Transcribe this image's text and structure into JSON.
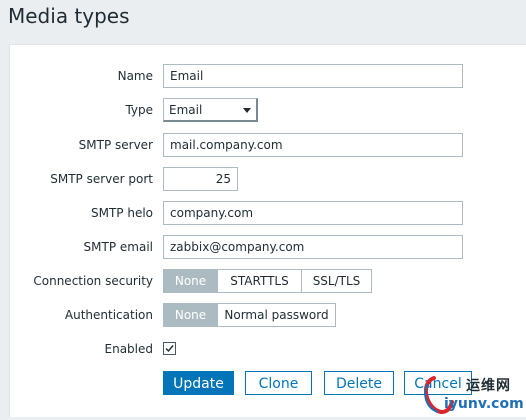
{
  "page": {
    "title": "Media types"
  },
  "form": {
    "name": {
      "label": "Name",
      "value": "Email"
    },
    "type": {
      "label": "Type",
      "value": "Email"
    },
    "smtp_server": {
      "label": "SMTP server",
      "value": "mail.company.com"
    },
    "smtp_port": {
      "label": "SMTP server port",
      "value": "25"
    },
    "smtp_helo": {
      "label": "SMTP helo",
      "value": "company.com"
    },
    "smtp_email": {
      "label": "SMTP email",
      "value": "zabbix@company.com"
    },
    "connection_security": {
      "label": "Connection security",
      "options": [
        "None",
        "STARTTLS",
        "SSL/TLS"
      ],
      "selected": "None"
    },
    "authentication": {
      "label": "Authentication",
      "options": [
        "None",
        "Normal password"
      ],
      "selected": "None"
    },
    "enabled": {
      "label": "Enabled",
      "checked": true
    }
  },
  "buttons": {
    "update": "Update",
    "clone": "Clone",
    "delete": "Delete",
    "cancel": "Cancel"
  },
  "watermark": {
    "text_cn": "运维网",
    "text_url": "iyunv.com"
  },
  "colors": {
    "primary": "#0275b8",
    "segment_active": "#acbbc2",
    "background": "#ebeef0",
    "watermark_red": "#d9262c",
    "watermark_blue": "#1e6fb8"
  }
}
